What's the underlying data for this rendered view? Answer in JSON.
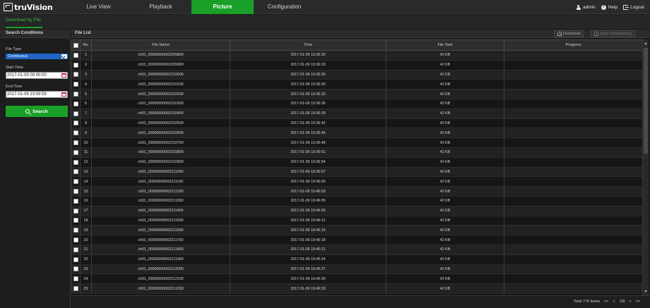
{
  "brand": {
    "name": "truVision"
  },
  "nav": {
    "tabs": [
      {
        "label": "Live View"
      },
      {
        "label": "Playback"
      },
      {
        "label": "Picture"
      },
      {
        "label": "Configuration"
      }
    ],
    "active": "Picture",
    "user": "admin",
    "help": "Help",
    "logout": "Logout"
  },
  "subnav": {
    "tab": "Download by File"
  },
  "search_conditions": {
    "title": "Search Conditions",
    "file_type_label": "File Type",
    "file_type_value": "Continuous",
    "start_time_label": "Start Time",
    "start_time_value": "2017-01-09 00:00:00",
    "end_time_label": "End Time",
    "end_time_value": "2017-01-09 23:59:59",
    "search_button": "Search"
  },
  "file_list": {
    "title": "File List",
    "download_button": "Download",
    "stop_button": "Stop Downloading",
    "columns": {
      "no": "No.",
      "file_name": "File Name",
      "time": "Time",
      "file_size": "File Size",
      "progress": "Progress"
    },
    "rows": [
      {
        "no": "1",
        "name": "ch01_00000000002209800",
        "time": "2017-01-09 19:36:20",
        "size": "42 KB"
      },
      {
        "no": "2",
        "name": "ch01_00000000002209900",
        "time": "2017-01-09 19:36:23",
        "size": "42 KB"
      },
      {
        "no": "3",
        "name": "ch01_00000000002210000",
        "time": "2017-01-09 19:36:26",
        "size": "42 KB"
      },
      {
        "no": "4",
        "name": "ch01_00000000002210100",
        "time": "2017-01-09 19:36:30",
        "size": "42 KB"
      },
      {
        "no": "5",
        "name": "ch01_00000000002210200",
        "time": "2017-01-09 19:36:33",
        "size": "42 KB"
      },
      {
        "no": "6",
        "name": "ch01_00000000002210300",
        "time": "2017-01-09 19:36:36",
        "size": "42 KB"
      },
      {
        "no": "7",
        "name": "ch01_00000000002210400",
        "time": "2017-01-09 19:36:39",
        "size": "42 KB"
      },
      {
        "no": "8",
        "name": "ch01_00000000002210500",
        "time": "2017-01-09 19:36:42",
        "size": "42 KB"
      },
      {
        "no": "9",
        "name": "ch01_00000000002210600",
        "time": "2017-01-09 19:36:45",
        "size": "42 KB"
      },
      {
        "no": "10",
        "name": "ch01_00000000002210700",
        "time": "2017-01-09 19:36:48",
        "size": "42 KB"
      },
      {
        "no": "11",
        "name": "ch01_00000000002210800",
        "time": "2017-01-09 19:36:51",
        "size": "42 KB"
      },
      {
        "no": "12",
        "name": "ch01_00000000002210900",
        "time": "2017-01-09 19:36:54",
        "size": "42 KB"
      },
      {
        "no": "13",
        "name": "ch01_00000000002211000",
        "time": "2017-01-09 19:36:57",
        "size": "42 KB"
      },
      {
        "no": "14",
        "name": "ch01_00000000002211100",
        "time": "2017-01-09 19:40:00",
        "size": "42 KB"
      },
      {
        "no": "15",
        "name": "ch01_00000000002211200",
        "time": "2017-01-09 19:40:03",
        "size": "42 KB"
      },
      {
        "no": "16",
        "name": "ch01_00000000002211300",
        "time": "2017-01-09 19:40:06",
        "size": "42 KB"
      },
      {
        "no": "17",
        "name": "ch01_00000000002211400",
        "time": "2017-01-09 19:40:09",
        "size": "42 KB"
      },
      {
        "no": "18",
        "name": "ch01_00000000002211500",
        "time": "2017-01-09 19:40:12",
        "size": "42 KB"
      },
      {
        "no": "19",
        "name": "ch01_00000000002211600",
        "time": "2017-01-09 19:40:15",
        "size": "42 KB"
      },
      {
        "no": "20",
        "name": "ch01_00000000002211700",
        "time": "2017-01-09 19:40:18",
        "size": "42 KB"
      },
      {
        "no": "21",
        "name": "ch01_00000000002211800",
        "time": "2017-01-09 19:40:21",
        "size": "42 KB"
      },
      {
        "no": "22",
        "name": "ch01_00000000002211900",
        "time": "2017-01-09 19:40:24",
        "size": "42 KB"
      },
      {
        "no": "23",
        "name": "ch01_00000000002212000",
        "time": "2017-01-09 19:40:27",
        "size": "42 KB"
      },
      {
        "no": "24",
        "name": "ch01_00000000002212100",
        "time": "2017-01-09 19:40:30",
        "size": "42 KB"
      },
      {
        "no": "25",
        "name": "ch01_00000000002212200",
        "time": "2017-01-09 19:40:33",
        "size": "42 KB"
      }
    ]
  },
  "pager": {
    "total": "Total 775 Items",
    "first": "<<",
    "prev": "<",
    "page": "1/8",
    "next": ">",
    "last": ">>"
  },
  "colors": {
    "accent": "#1aa028",
    "background": "#1a1a1a",
    "row_alt": "#222222"
  }
}
